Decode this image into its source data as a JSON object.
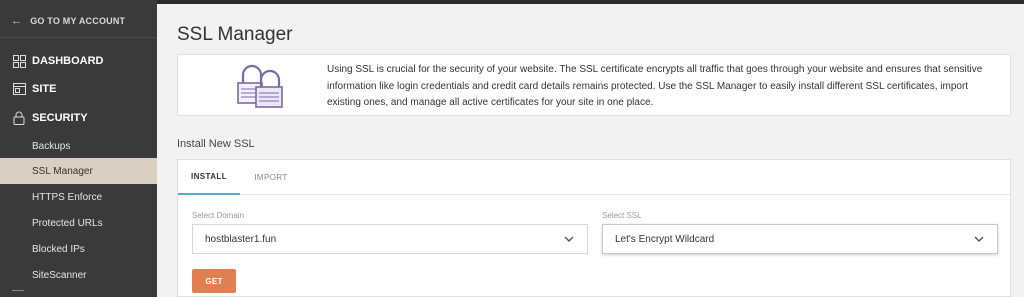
{
  "sidebar": {
    "go_to_account": "GO TO MY ACCOUNT",
    "sections": [
      {
        "label": "DASHBOARD",
        "icon": "grid-icon"
      },
      {
        "label": "SITE",
        "icon": "window-icon"
      },
      {
        "label": "SECURITY",
        "icon": "lock-icon"
      }
    ],
    "items": [
      {
        "label": "Backups"
      },
      {
        "label": "SSL Manager",
        "active": true
      },
      {
        "label": "HTTPS Enforce"
      },
      {
        "label": "Protected URLs"
      },
      {
        "label": "Blocked IPs"
      },
      {
        "label": "SiteScanner"
      }
    ]
  },
  "main": {
    "title": "SSL Manager",
    "info_text": "Using SSL is crucial for the security of your website. The SSL certificate encrypts all traffic that goes through your website and ensures that sensitive information like login credentials and credit card details remains protected. Use the SSL Manager to easily install different SSL certificates, import existing ones, and manage all active certificates for your site in one place.",
    "section_label": "Install New SSL",
    "tabs": [
      {
        "label": "INSTALL",
        "active": true
      },
      {
        "label": "IMPORT",
        "active": false
      }
    ],
    "domain_label": "Select Domain",
    "domain_value": "hostblaster1.fun",
    "ssl_label": "Select SSL",
    "ssl_value": "Let's Encrypt Wildcard",
    "get_label": "GET"
  },
  "colors": {
    "sidebar_bg": "#3a3a3a",
    "active_item_bg": "#d9cfc2",
    "accent_tab": "#5aa9c8",
    "button": "#e07f4f",
    "lock_purple": "#7a6aa8"
  }
}
